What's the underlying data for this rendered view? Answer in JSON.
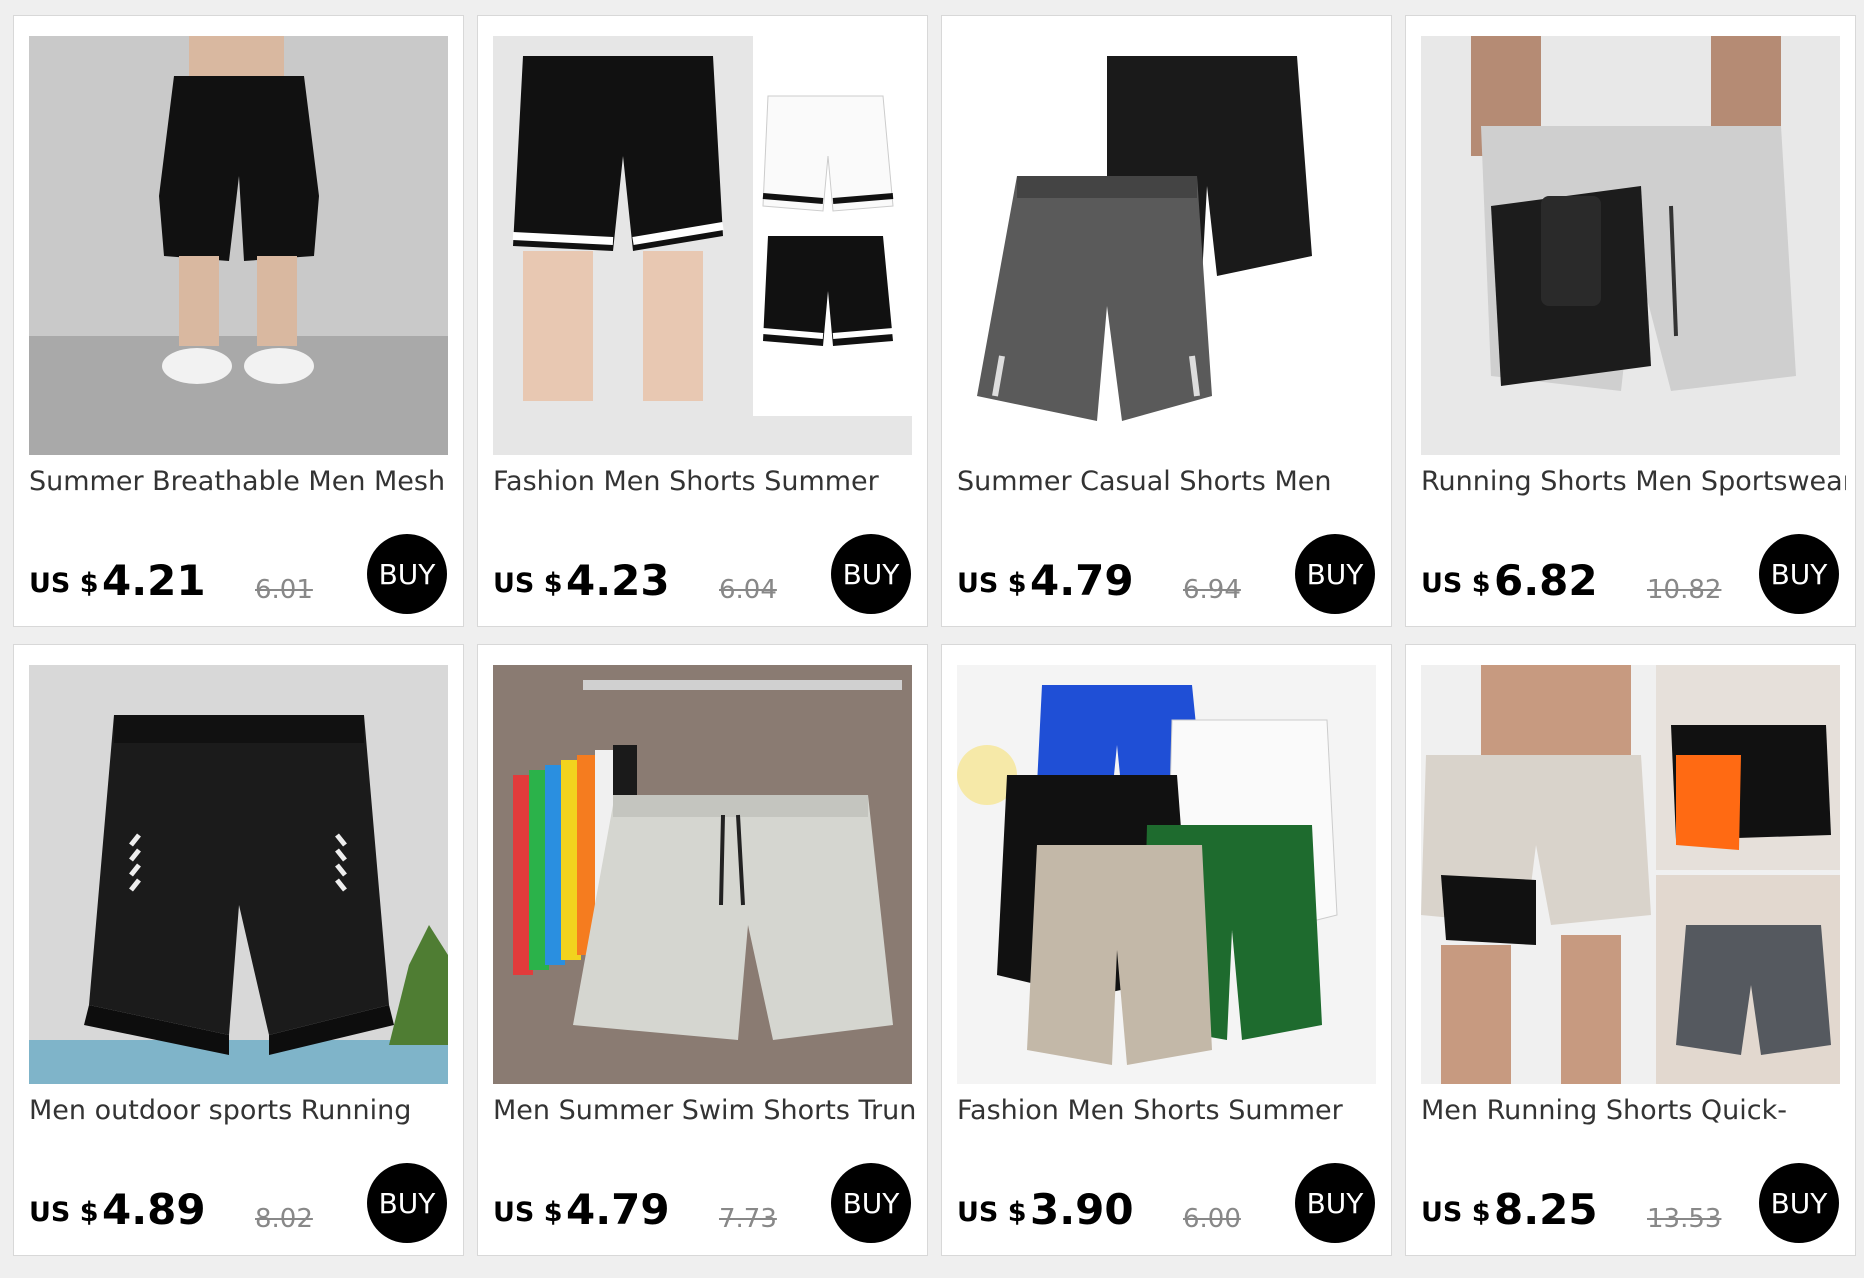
{
  "currency": "US $",
  "buy_label": "BUY",
  "products": [
    {
      "title": "Summer Breathable Men Mesh",
      "price": "4.21",
      "original_price": "6.01",
      "image_icon": "black-shorts-on-model"
    },
    {
      "title": "Fashion Men Shorts Summer",
      "price": "4.23",
      "original_price": "6.04",
      "image_icon": "basketball-shorts-stripes"
    },
    {
      "title": "Summer Casual Shorts Men",
      "price": "4.79",
      "original_price": "6.94",
      "image_icon": "grey-and-black-shorts"
    },
    {
      "title": "Running Shorts Men Sportswear",
      "price": "6.82",
      "original_price": "10.82",
      "image_icon": "compression-running-shorts"
    },
    {
      "title": "Men outdoor sports Running",
      "price": "4.89",
      "original_price": "8.02",
      "image_icon": "black-reflective-running-shorts"
    },
    {
      "title": "Men Summer Swim Shorts Trunks",
      "price": "4.79",
      "original_price": "7.73",
      "image_icon": "swim-shorts-on-hangers"
    },
    {
      "title": "Fashion Men Shorts Summer",
      "price": "3.90",
      "original_price": "6.00",
      "image_icon": "colorful-shorts-pile"
    },
    {
      "title": "Men Running Shorts Quick-",
      "price": "8.25",
      "original_price": "13.53",
      "image_icon": "two-in-one-running-shorts"
    }
  ]
}
